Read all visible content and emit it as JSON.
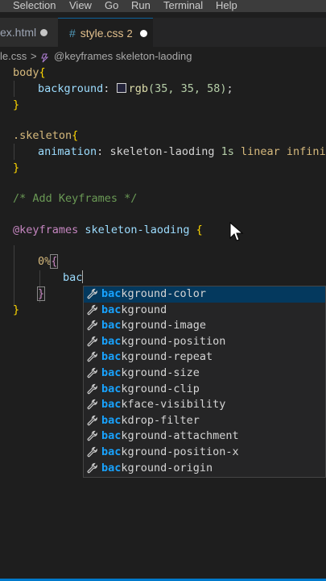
{
  "menu": [
    "Selection",
    "View",
    "Go",
    "Run",
    "Terminal",
    "Help"
  ],
  "tabs": [
    {
      "label": "ex.html",
      "modified": true
    },
    {
      "label": "style.css",
      "problems": "2",
      "modified": true
    }
  ],
  "breadcrumb": {
    "file": "le.css",
    "separator": ">",
    "symbol": "@keyframes skeleton-laoding"
  },
  "code": {
    "body_sel": "body",
    "brace_open": "{",
    "brace_close": "}",
    "background_prop": "background",
    "colon": ":",
    "rgb_fn": "rgb",
    "rgb_args": "(35, 35, 58)",
    "semicolon": ";",
    "skeleton_sel": ".skeleton",
    "animation_prop": "animation",
    "anim_name": "skeleton-laoding",
    "anim_dur": "1s",
    "anim_rest": "linear infinite",
    "comment": "/* Add Keyframes */",
    "at_keyword": "@keyframes",
    "kf_name": "skeleton-laoding",
    "pct": "0%",
    "typed": "bac"
  },
  "suggestions": {
    "typed_prefix": "bac",
    "items": [
      {
        "prefix": "bac",
        "rest": "kground-color",
        "active": true
      },
      {
        "prefix": "bac",
        "rest": "kground"
      },
      {
        "prefix": "bac",
        "rest": "kground-image"
      },
      {
        "prefix": "bac",
        "rest": "kground-position"
      },
      {
        "prefix": "bac",
        "rest": "kground-repeat"
      },
      {
        "prefix": "bac",
        "rest": "kground-size"
      },
      {
        "prefix": "bac",
        "rest": "kground-clip"
      },
      {
        "prefix": "bac",
        "rest": "kface-visibility"
      },
      {
        "prefix": "bac",
        "rest": "kdrop-filter"
      },
      {
        "prefix": "bac",
        "rest": "kground-attachment"
      },
      {
        "prefix": "bac",
        "rest": "kground-position-x"
      },
      {
        "prefix": "bac",
        "rest": "kground-origin"
      }
    ],
    "icon": "wrench-icon"
  },
  "colors": {
    "accent": "#007acc",
    "match": "#18a3ff",
    "selected_row": "#04395e",
    "modified_tab": "#e2c08d"
  }
}
